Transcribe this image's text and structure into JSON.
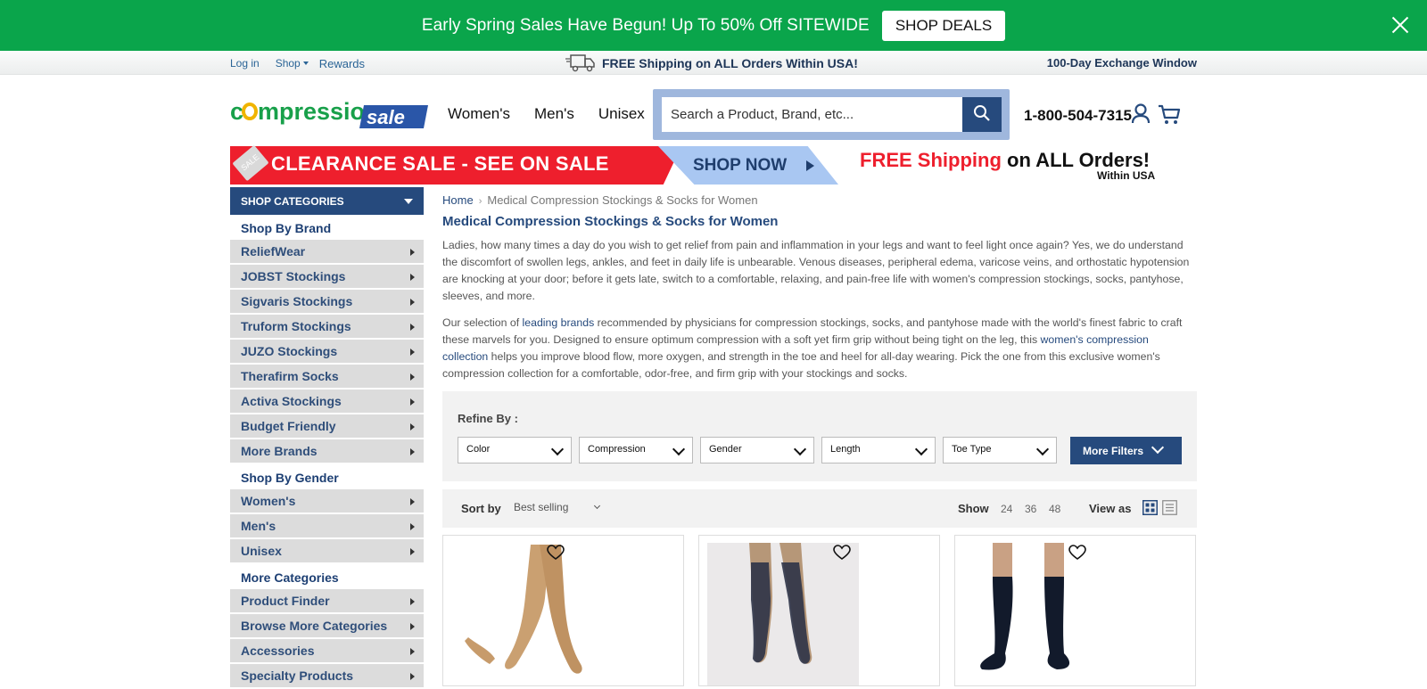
{
  "promo": {
    "text": "Early Spring Sales Have Begun! Up To 50% Off SITEWIDE",
    "button": "SHOP DEALS",
    "bg_color": "#0aa54b"
  },
  "utility": {
    "login": "Log in",
    "shop": "Shop",
    "rewards": "Rewards",
    "shipping": "FREE Shipping on ALL Orders Within USA!",
    "exchange": "100-Day Exchange Window"
  },
  "header": {
    "logo_alt": "compression sale",
    "nav": [
      "Women's",
      "Men's",
      "Unisex"
    ],
    "search_placeholder": "Search a Product, Brand, etc...",
    "phone": "1-800-504-7315",
    "accent": "#264a7d"
  },
  "banner": {
    "clearance": "CLEARANCE SALE - SEE ON SALE",
    "tag": "SALE",
    "shop_now": "SHOP NOW",
    "free_red": "FREE Shipping",
    "free_rest": " on ALL Orders!",
    "within": "Within USA"
  },
  "sidebar": {
    "header": "SHOP CATEGORIES",
    "group_brand": "Shop By Brand",
    "brands": [
      "ReliefWear",
      "JOBST Stockings",
      "Sigvaris Stockings",
      "Truform Stockings",
      "JUZO Stockings",
      "Therafirm Socks",
      "Activa Stockings",
      "Budget Friendly",
      "More Brands"
    ],
    "group_gender": "Shop By Gender",
    "genders": [
      "Women's",
      "Men's",
      "Unisex"
    ],
    "group_more": "More Categories",
    "more": [
      "Product Finder",
      "Browse More Categories",
      "Accessories",
      "Specialty Products"
    ]
  },
  "main": {
    "breadcrumb_home": "Home",
    "breadcrumb_current": "Medical Compression Stockings & Socks for Women",
    "title": "Medical Compression Stockings & Socks for Women",
    "para1": "Ladies, how many times a day do you wish to get relief from pain and inflammation in your legs and want to feel light once again? Yes, we do understand the discomfort of swollen legs, ankles, and feet in daily life is unbearable. Venous diseases, peripheral edema, varicose veins, and orthostatic hypotension are knocking at your door; before it gets late, switch to a comfortable, relaxing, and pain-free life with women's compression stockings, socks, pantyhose, sleeves, and more.",
    "para2_a": "Our selection of ",
    "para2_link1": "leading brands",
    "para2_b": " recommended by physicians for compression stockings, socks, and pantyhose made with the world's finest fabric to craft these marvels for you. Designed to ensure optimum compression with a soft yet firm grip without being tight on the leg, this ",
    "para2_link2": "women's compression collection",
    "para2_c": " helps you improve blood flow, more oxygen, and strength in the toe and heel for all-day wearing. Pick the one from this exclusive women's compression collection for a comfortable, odor-free, and firm grip with your stockings and socks."
  },
  "refine": {
    "label": "Refine By :",
    "filters": [
      "Color",
      "Compression",
      "Gender",
      "Length",
      "Toe Type"
    ],
    "more": "More Filters"
  },
  "sort": {
    "label": "Sort by",
    "value": "Best selling",
    "show_label": "Show",
    "show_options": [
      "24",
      "36",
      "48"
    ],
    "view_label": "View as"
  },
  "products": [
    {
      "skin": "#c49a6c",
      "sock": "#c8a070"
    },
    {
      "skin": "#b69778",
      "sock": "#3a3f55"
    },
    {
      "skin": "#c9a184",
      "sock": "#121a2b"
    }
  ]
}
